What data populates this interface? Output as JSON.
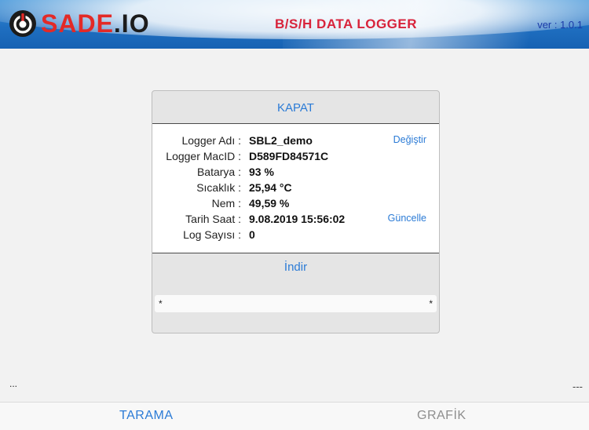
{
  "header": {
    "logo_sade": "SADE",
    "logo_io": ".IO",
    "title": "B/S/H DATA LOGGER",
    "version": "ver : 1.0.1"
  },
  "card": {
    "close_label": "KAPAT",
    "rows": [
      {
        "label": "Logger Adı :",
        "value": "SBL2_demo",
        "action": "Değiştir"
      },
      {
        "label": "Logger MacID :",
        "value": "D589FD84571C",
        "action": ""
      },
      {
        "label": "Batarya :",
        "value": "93 %",
        "action": ""
      },
      {
        "label": "Sıcaklık :",
        "value": "25,94 °C",
        "action": ""
      },
      {
        "label": "Nem :",
        "value": "49,59 %",
        "action": ""
      },
      {
        "label": "Tarih Saat :",
        "value": "9.08.2019 15:56:02",
        "action": "Güncelle"
      },
      {
        "label": "Log Sayısı :",
        "value": "0",
        "action": ""
      }
    ],
    "download_label": "İndir",
    "status_left": "*",
    "status_right": "*"
  },
  "footer": {
    "left_text": "...",
    "right_text": "---"
  },
  "tabs": [
    {
      "label": "TARAMA",
      "active": true
    },
    {
      "label": "GRAFİK",
      "active": false
    }
  ],
  "colors": {
    "accent": "#2b7bd6",
    "brand_red": "#e32a27",
    "title_red": "#d8233b"
  }
}
